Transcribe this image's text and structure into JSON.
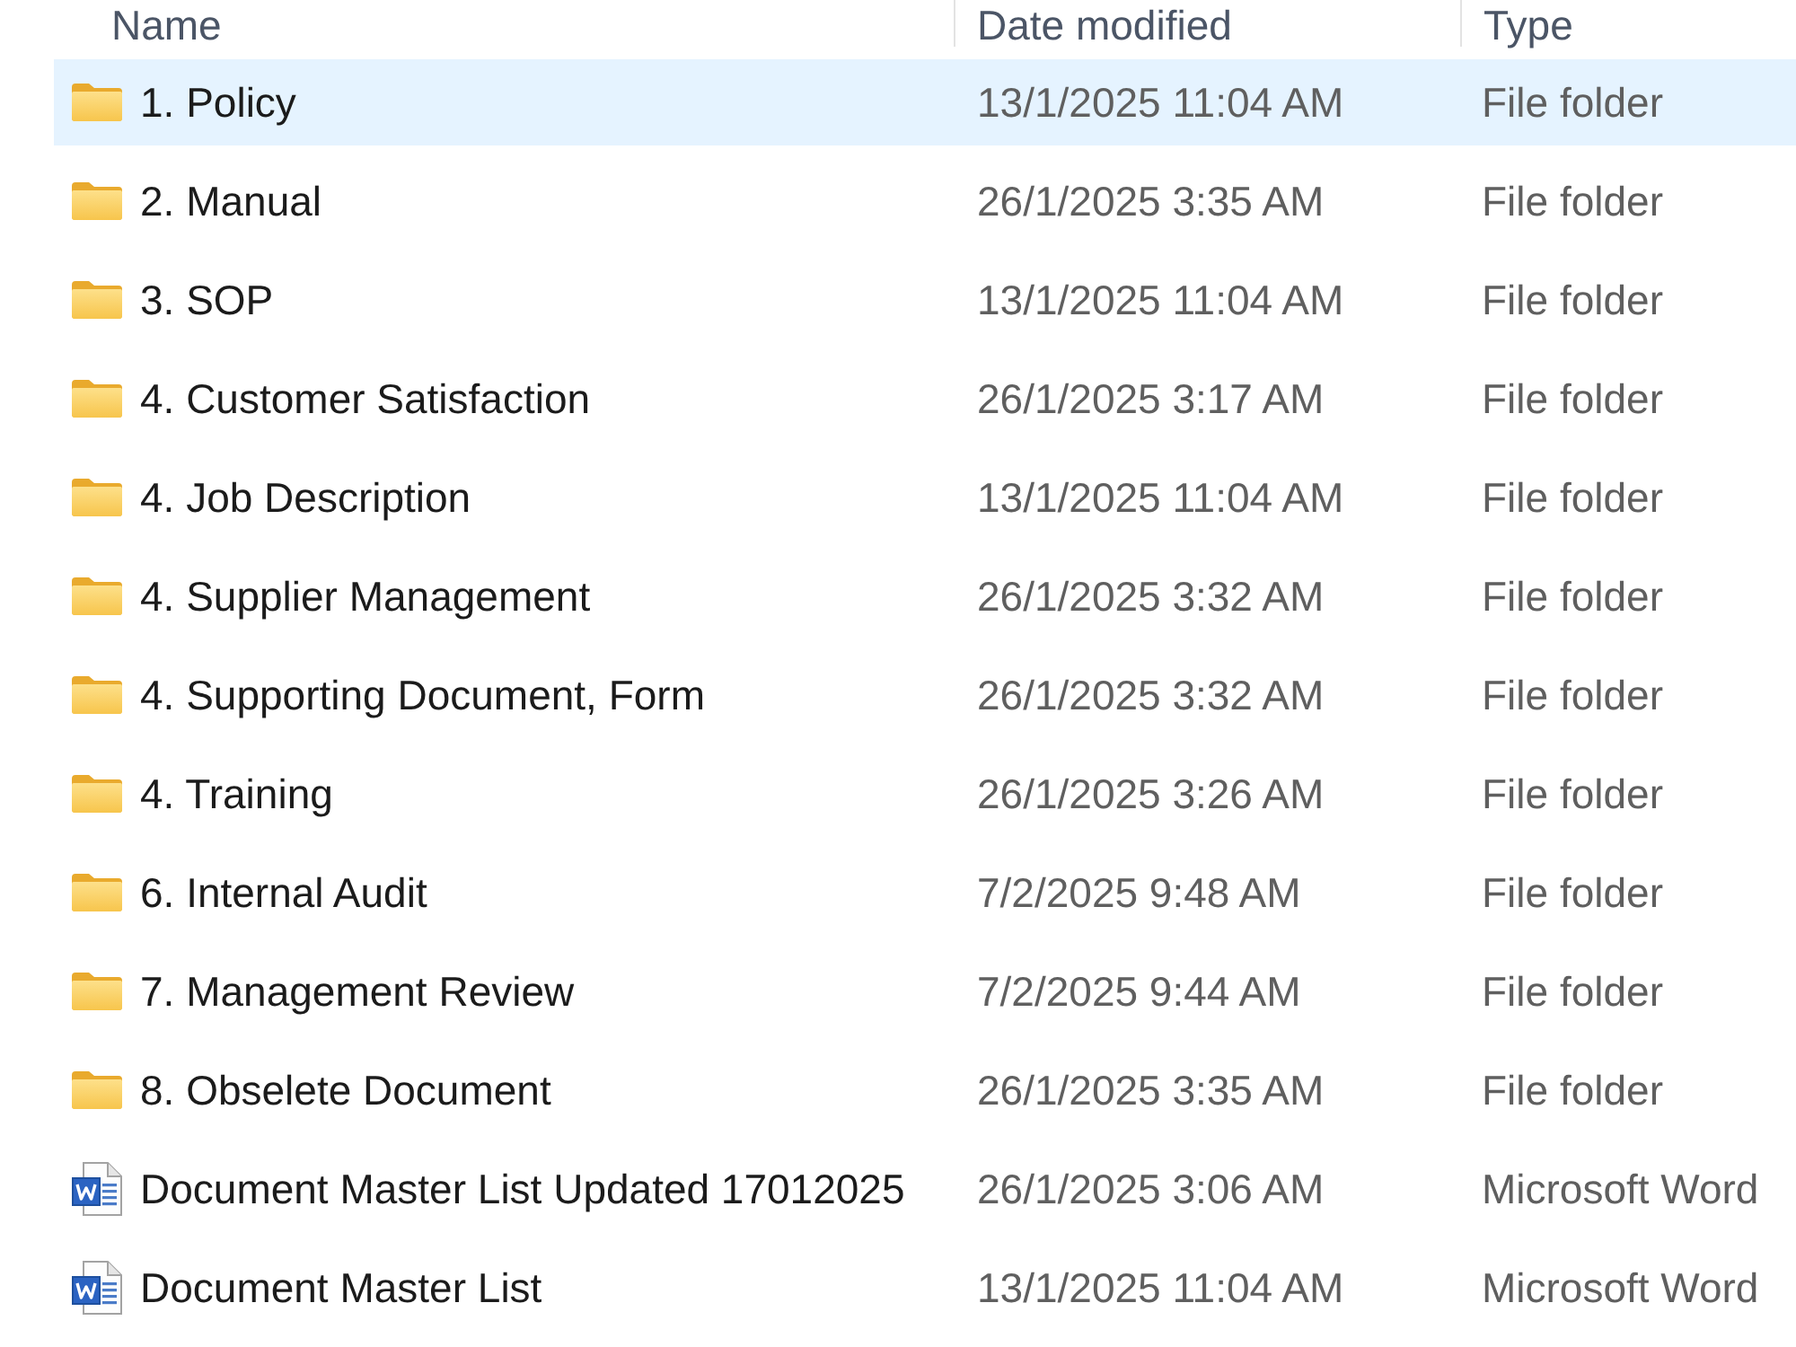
{
  "columns": [
    {
      "label": "Name"
    },
    {
      "label": "Date modified"
    },
    {
      "label": "Type"
    }
  ],
  "rows": [
    {
      "kind": "folder",
      "name": "1. Policy",
      "date_modified": "13/1/2025 11:04 AM",
      "type": "File folder",
      "selected": true
    },
    {
      "kind": "folder",
      "name": "2. Manual",
      "date_modified": "26/1/2025 3:35 AM",
      "type": "File folder",
      "selected": false
    },
    {
      "kind": "folder",
      "name": "3. SOP",
      "date_modified": "13/1/2025 11:04 AM",
      "type": "File folder",
      "selected": false
    },
    {
      "kind": "folder",
      "name": "4. Customer Satisfaction",
      "date_modified": "26/1/2025 3:17 AM",
      "type": "File folder",
      "selected": false
    },
    {
      "kind": "folder",
      "name": "4. Job Description",
      "date_modified": "13/1/2025 11:04 AM",
      "type": "File folder",
      "selected": false
    },
    {
      "kind": "folder",
      "name": "4. Supplier Management",
      "date_modified": "26/1/2025 3:32 AM",
      "type": "File folder",
      "selected": false
    },
    {
      "kind": "folder",
      "name": "4. Supporting Document, Form",
      "date_modified": "26/1/2025 3:32 AM",
      "type": "File folder",
      "selected": false
    },
    {
      "kind": "folder",
      "name": "4. Training",
      "date_modified": "26/1/2025 3:26 AM",
      "type": "File folder",
      "selected": false
    },
    {
      "kind": "folder",
      "name": "6. Internal Audit",
      "date_modified": "7/2/2025 9:48 AM",
      "type": "File folder",
      "selected": false
    },
    {
      "kind": "folder",
      "name": "7. Management Review",
      "date_modified": "7/2/2025 9:44 AM",
      "type": "File folder",
      "selected": false
    },
    {
      "kind": "folder",
      "name": "8. Obselete Document",
      "date_modified": "26/1/2025 3:35 AM",
      "type": "File folder",
      "selected": false
    },
    {
      "kind": "document",
      "name": "Document Master List Updated 17012025",
      "date_modified": "26/1/2025 3:06 AM",
      "type": "Microsoft Word",
      "selected": false
    },
    {
      "kind": "document",
      "name": "Document Master List",
      "date_modified": "13/1/2025 11:04 AM",
      "type": "Microsoft Word",
      "selected": false
    }
  ]
}
